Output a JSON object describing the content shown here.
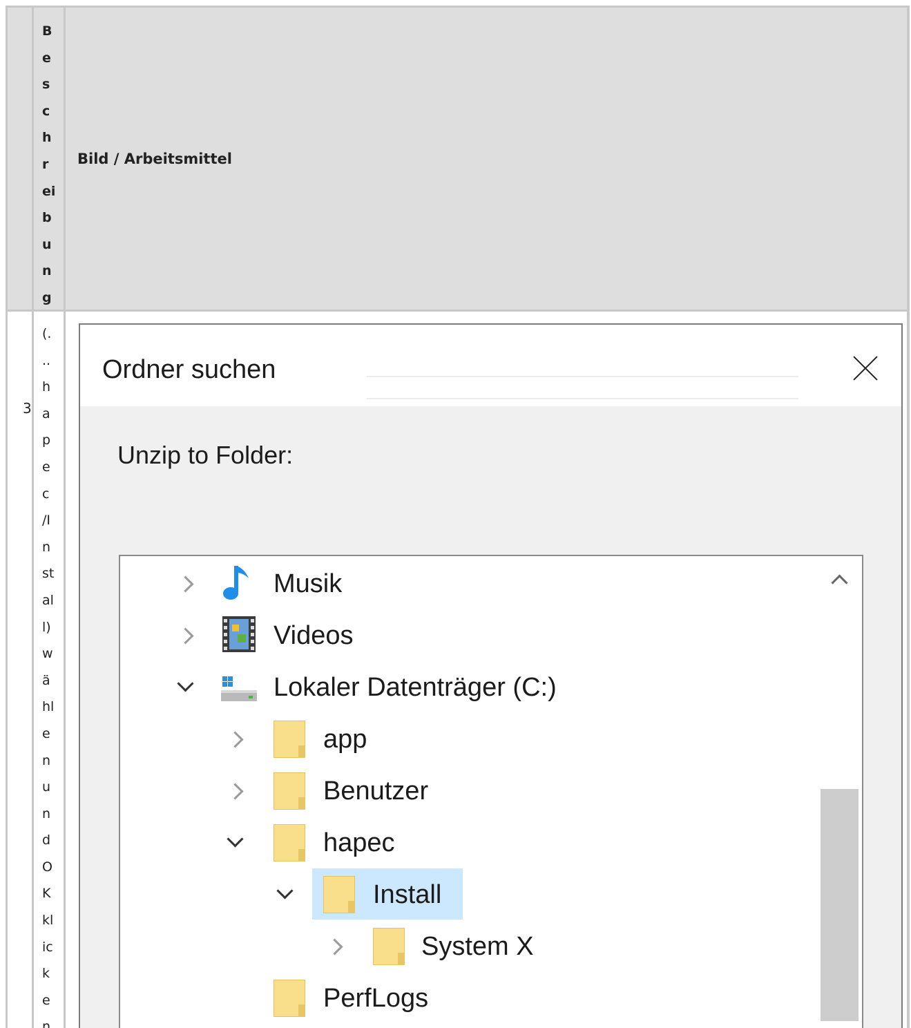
{
  "table": {
    "header": {
      "col1": "",
      "col2": "B\ne\ns\nc\nh\nr\nei\nb\nu\nn\ng",
      "col3": "Bild / Arbeitsmittel"
    },
    "row": {
      "number": "3",
      "description": "(.\n..\nh\na\np\ne\nc\n/I\nn\nst\nal\nl)\nw\nä\nhl\ne\nn\nu\nn\nd\nO\nK\nkl\nic\nk\ne\nn"
    }
  },
  "dialog": {
    "title": "Ordner suchen",
    "prompt": "Unzip to Folder:",
    "close_icon": "close-icon",
    "tree_items": [
      {
        "label": "Musik",
        "icon": "music-icon",
        "expander": "collapsed"
      },
      {
        "label": "Videos",
        "icon": "videos-icon",
        "expander": "collapsed"
      },
      {
        "label": "Lokaler Datenträger (C:)",
        "icon": "drive-icon",
        "expander": "expanded"
      },
      {
        "label": "app",
        "icon": "folder-icon",
        "expander": "collapsed"
      },
      {
        "label": "Benutzer",
        "icon": "folder-icon",
        "expander": "collapsed"
      },
      {
        "label": "hapec",
        "icon": "folder-icon",
        "expander": "expanded"
      },
      {
        "label": "Install",
        "icon": "folder-icon",
        "expander": "expanded",
        "selected": true
      },
      {
        "label": "System X",
        "icon": "folder-icon",
        "expander": "collapsed"
      },
      {
        "label": "PerfLogs",
        "icon": "folder-icon",
        "expander": "none"
      }
    ],
    "colors": {
      "selection": "#cce8ff",
      "folder": "#f9df8c",
      "music": "#1e8ee8"
    }
  }
}
